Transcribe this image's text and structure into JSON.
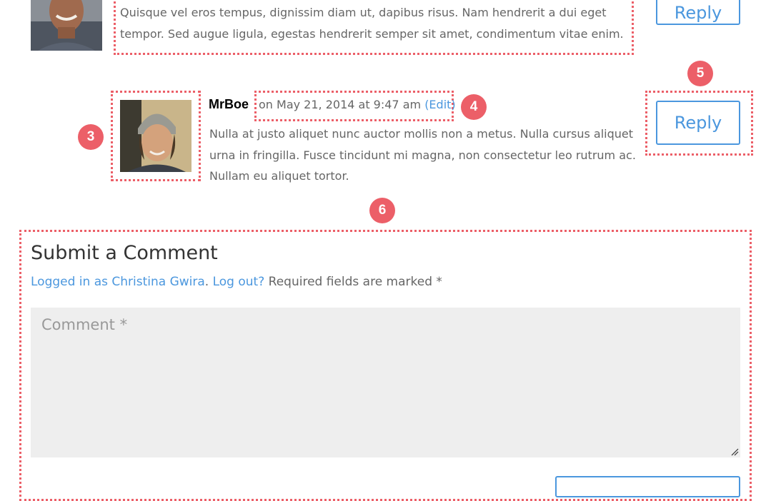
{
  "comments": [
    {
      "text_lines": [
        "Quisque vel eros tempus, dignissim diam ut, dapibus risus. Nam hendrerit a dui eget",
        "tempor. Sed augue ligula, egestas hendrerit semper sit amet, condimentum vitae enim."
      ],
      "reply_label": "Reply"
    },
    {
      "author": "MrBoe",
      "date": "on May 21, 2014 at 9:47 am",
      "edit_label": "(Edit)",
      "text_lines": [
        "Nulla at justo aliquet nunc auctor mollis non a metus. Nulla cursus aliquet",
        "urna in fringilla. Fusce tincidunt mi magna, non consectetur leo rutrum ac.",
        "Nullam eu aliquet tortor."
      ],
      "reply_label": "Reply"
    }
  ],
  "badges": [
    "3",
    "4",
    "5",
    "6"
  ],
  "form": {
    "title": "Submit a Comment",
    "logged_in_link": "Logged in as Christina Gwira",
    "separator": ".",
    "logout_link": "Log out?",
    "required_note": "Required fields are marked *",
    "comment_placeholder": "Comment *"
  },
  "colors": {
    "accent": "#4b97de",
    "annotation": "#ec5f68",
    "text": "#666666",
    "heading": "#333333",
    "field_bg": "#eeeeee"
  },
  "icons": {
    "resize_handle": "textarea-resize-icon"
  }
}
